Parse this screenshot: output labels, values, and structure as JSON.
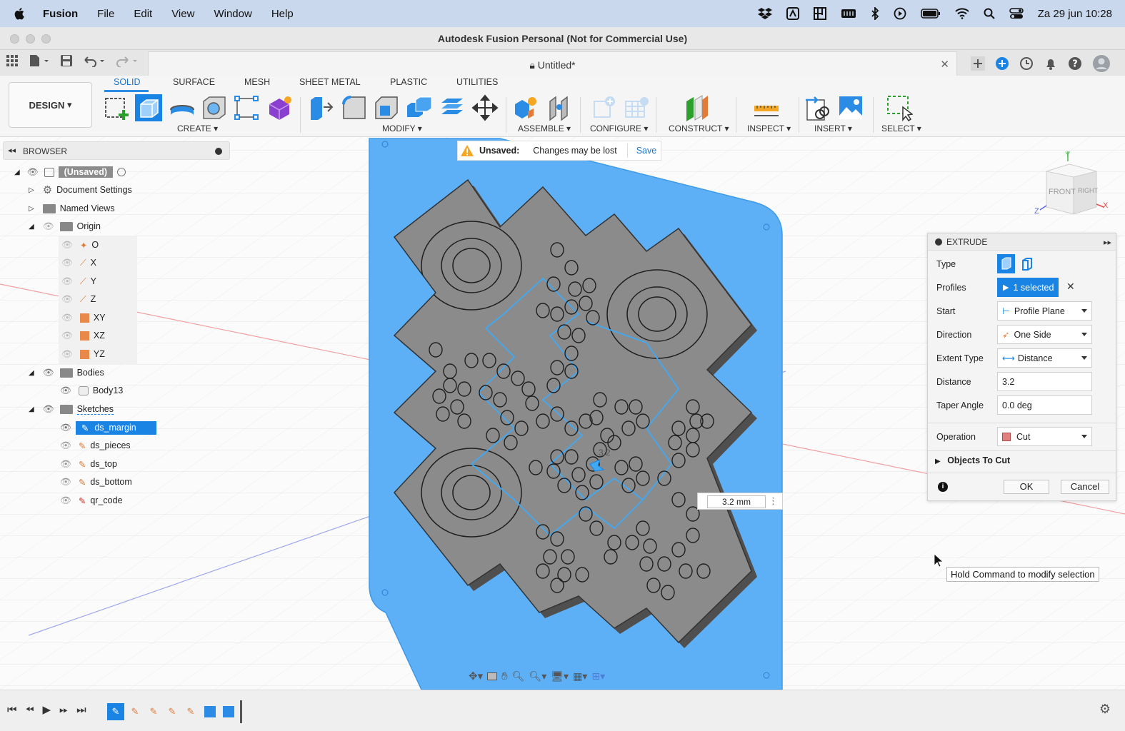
{
  "menubar": {
    "app_name": "Fusion",
    "items": [
      "File",
      "Edit",
      "View",
      "Window",
      "Help"
    ],
    "clock": "Za 29 jun  10:28"
  },
  "window": {
    "title": "Autodesk Fusion Personal (Not for Commercial Use)"
  },
  "document_tab": {
    "title": "Untitled*"
  },
  "toolbar": {
    "design_label": "DESIGN",
    "tabs": [
      "SOLID",
      "SURFACE",
      "MESH",
      "SHEET METAL",
      "PLASTIC",
      "UTILITIES"
    ],
    "groups": [
      "CREATE",
      "MODIFY",
      "ASSEMBLE",
      "CONFIGURE",
      "CONSTRUCT",
      "INSPECT",
      "INSERT",
      "SELECT"
    ]
  },
  "browser": {
    "title": "BROWSER",
    "root": "(Unsaved)",
    "items": {
      "document_settings": "Document Settings",
      "named_views": "Named Views",
      "origin": "Origin",
      "o": "O",
      "x": "X",
      "y": "Y",
      "z": "Z",
      "xy": "XY",
      "xz": "XZ",
      "yz": "YZ",
      "bodies": "Bodies",
      "body13": "Body13",
      "sketches": "Sketches",
      "ds_margin": "ds_margin",
      "ds_pieces": "ds_pieces",
      "ds_top": "ds_top",
      "ds_bottom": "ds_bottom",
      "qr_code": "qr_code"
    }
  },
  "unsaved_banner": {
    "label": "Unsaved:",
    "message": "Changes may be lost",
    "save": "Save"
  },
  "extrude": {
    "title": "EXTRUDE",
    "type_label": "Type",
    "profiles_label": "Profiles",
    "profiles_value": "1 selected",
    "start_label": "Start",
    "start_value": "Profile Plane",
    "direction_label": "Direction",
    "direction_value": "One Side",
    "extent_label": "Extent Type",
    "extent_value": "Distance",
    "distance_label": "Distance",
    "distance_value": "3.2",
    "taper_label": "Taper Angle",
    "taper_value": "0.0 deg",
    "operation_label": "Operation",
    "operation_value": "Cut",
    "objects_label": "Objects To Cut",
    "ok": "OK",
    "cancel": "Cancel"
  },
  "viewcube": {
    "front": "FRONT",
    "right": "RIGHT",
    "axis_x": "X",
    "axis_y": "Y",
    "axis_z": "Z"
  },
  "dimension": {
    "value": "3.2 mm",
    "canvas_label": "3.2"
  },
  "tooltip": "Hold Command to modify selection",
  "colors": {
    "accent": "#1a84e4",
    "plate": "#5eb0f6",
    "body": "#8b8b8b"
  }
}
